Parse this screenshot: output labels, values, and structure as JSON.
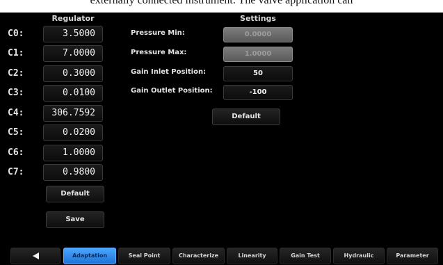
{
  "caption": "externally connected instrument. The valve application can",
  "regulator": {
    "header": "Regulator",
    "coefficients": [
      {
        "label": "C0:",
        "value": "3.5000"
      },
      {
        "label": "C1:",
        "value": "7.0000"
      },
      {
        "label": "C2:",
        "value": "0.3000"
      },
      {
        "label": "C3:",
        "value": "0.0100"
      },
      {
        "label": "C4:",
        "value": "306.7592"
      },
      {
        "label": "C5:",
        "value": "0.0200"
      },
      {
        "label": "C6:",
        "value": "1.0000"
      },
      {
        "label": "C7:",
        "value": "0.9800"
      }
    ],
    "default_label": "Default",
    "save_label": "Save"
  },
  "settings": {
    "header": "Settings",
    "rows": [
      {
        "label": "Pressure Min:",
        "value": "0.0000",
        "disabled": true
      },
      {
        "label": "Pressure Max:",
        "value": "1.0000",
        "disabled": true
      },
      {
        "label": "Gain Inlet Position:",
        "value": "50",
        "disabled": false
      },
      {
        "label": "Gain Outlet Position:",
        "value": "-100",
        "disabled": false
      }
    ],
    "default_label": "Default"
  },
  "tabs": [
    {
      "label": "",
      "icon": "back-arrow-icon",
      "active": false
    },
    {
      "label": "Adaptation",
      "active": true
    },
    {
      "label": "Seal Point",
      "active": false
    },
    {
      "label": "Characterize",
      "active": false
    },
    {
      "label": "Linearity",
      "active": false
    },
    {
      "label": "Gain Test",
      "active": false
    },
    {
      "label": "Hydraulic",
      "active": false
    },
    {
      "label": "Parameter",
      "active": false
    }
  ],
  "colors": {
    "background": "#000000",
    "active_tab": "#2f8cf0",
    "disabled_field": "#6a6a6a"
  }
}
